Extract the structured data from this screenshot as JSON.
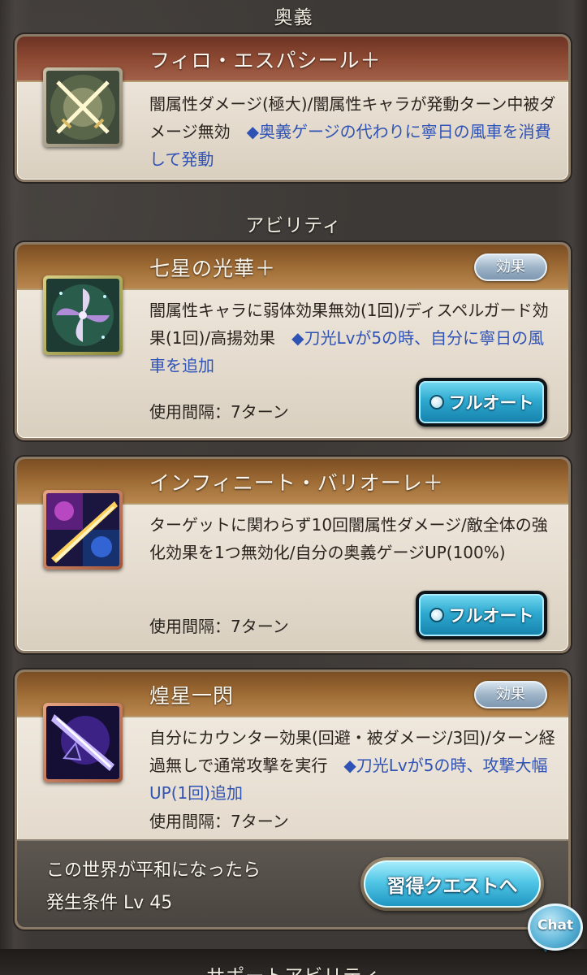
{
  "sections": {
    "ougi_heading": "奥義",
    "ability_heading": "アビリティ",
    "support_heading": "サポートアビリティ"
  },
  "ougi": {
    "name": "フィロ・エスパシール＋",
    "desc": "闇属性ダメージ(極大)/闇属性キャラが発動ターン中被ダメージ無効　",
    "note": "◆奥義ゲージの代わりに寧日の風車を消費して発動",
    "icon": "crossed-swords-icon"
  },
  "abilities": [
    {
      "name": "七星の光華＋",
      "effect_label": "効果",
      "desc": "闇属性キャラに弱体効果無効(1回)/ディスペルガード効果(1回)/高揚効果　",
      "note": "◆刀光Lvが5の時、自分に寧日の風車を追加",
      "cooldown": "使用間隔：7ターン",
      "auto_label": "フルオート",
      "icon": "pinwheel-icon"
    },
    {
      "name": "インフィニート・バリオーレ＋",
      "effect_label": "",
      "desc": "ターゲットに関わらず10回闇属性ダメージ/敵全体の強化効果を1つ無効化/自分の奥義ゲージUP(100%)",
      "note": "",
      "cooldown": "使用間隔：7ターン",
      "auto_label": "フルオート",
      "icon": "fireworks-slash-icon"
    },
    {
      "name": "煌星一閃",
      "effect_label": "効果",
      "desc": "自分にカウンター効果(回避・被ダメージ/3回)/ターン経過無しで通常攻撃を実行　",
      "note": "◆刀光Lvが5の時、攻撃大幅UP(1回)追加",
      "cooldown": "使用間隔：7ターン",
      "icon": "dark-slash-icon"
    }
  ],
  "quest": {
    "name": "この世界が平和になったら",
    "condition": "発生条件 Lv 45",
    "button_label": "習得クエストへ"
  },
  "chat": {
    "label": "Chat"
  }
}
